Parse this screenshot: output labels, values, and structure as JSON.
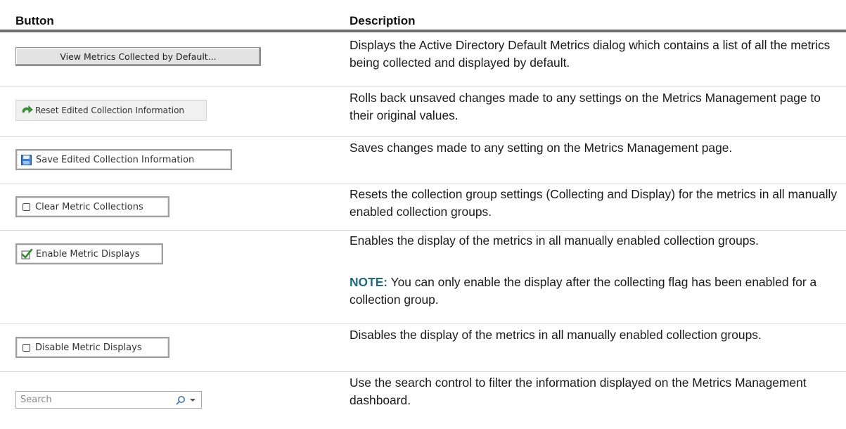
{
  "table": {
    "headers": {
      "button": "Button",
      "description": "Description"
    },
    "rows": [
      {
        "button_label": "View Metrics Collected by Default...",
        "description": "Displays the Active Directory Default Metrics dialog which contains a list of all the metrics being collected and displayed by default."
      },
      {
        "button_label": "Reset Edited Collection Information",
        "icon": "reset-arrow-icon",
        "description": "Rolls back unsaved changes made to any settings on the Metrics Management page to their original values."
      },
      {
        "button_label": "Save Edited Collection Information",
        "icon": "floppy-disk-icon",
        "description": "Saves changes made to any setting on the Metrics Management page."
      },
      {
        "button_label": "Clear Metric Collections",
        "icon": "checkbox-icon",
        "description": "Resets the collection group settings (Collecting and Display) for the metrics in all manually enabled collection groups."
      },
      {
        "button_label": "Enable Metric Displays",
        "icon": "checkbox-checked-icon",
        "description": "Enables the display of the metrics in all manually enabled collection groups.",
        "note_label": "NOTE:",
        "note_text": " You can only enable the display after the collecting flag has been enabled for a collection group."
      },
      {
        "button_label": "Disable Metric Displays",
        "icon": "checkbox-icon",
        "description": "Disables the display of the metrics in all manually enabled collection groups."
      },
      {
        "search_placeholder": "Search",
        "icon": "search-icon",
        "description": "Use the search control to filter the information displayed on the Metrics Management dashboard."
      }
    ]
  },
  "colors": {
    "header_rule": "#6e6e6e",
    "row_separator": "#d9d9d9",
    "note_accent": "#1f6b86"
  }
}
